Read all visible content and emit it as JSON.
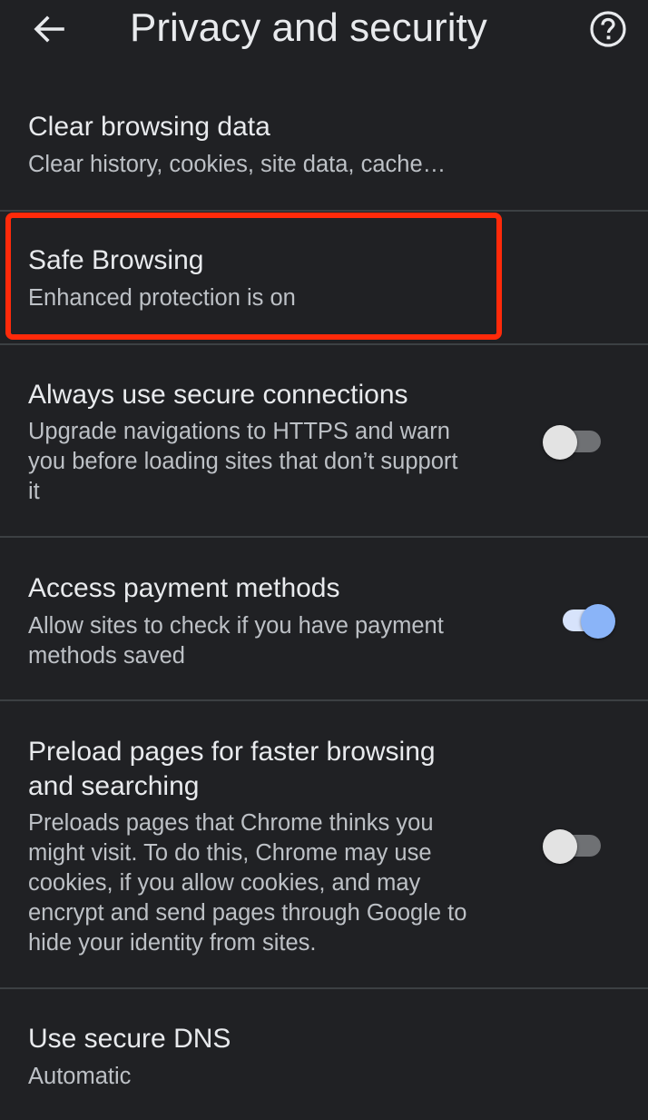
{
  "header": {
    "title": "Privacy and security",
    "back_icon": "arrow-left",
    "help_icon": "help-circle"
  },
  "rows": [
    {
      "title": "Clear browsing data",
      "subtitle": "Clear history, cookies, site data, cache…"
    },
    {
      "title": "Safe Browsing",
      "subtitle": "Enhanced protection is on"
    },
    {
      "title": "Always use secure connections",
      "subtitle": "Upgrade navigations to HTTPS and warn\nyou before loading sites that don’t support\nit",
      "toggle": "off"
    },
    {
      "title": "Access payment methods",
      "subtitle": "Allow sites to check if you have payment\nmethods saved",
      "toggle": "on"
    },
    {
      "title_line1": "Preload pages for faster browsing",
      "title_line2": "and searching",
      "subtitle": "Preloads pages that Chrome thinks you\nmight visit. To do this, Chrome may use\ncookies, if you allow cookies, and may\nencrypt and send pages through Google to\nhide your identity from sites.",
      "toggle": "off"
    },
    {
      "title": "Use secure DNS",
      "subtitle": "Automatic"
    }
  ],
  "colors": {
    "background": "#202124",
    "highlight": "#ff2a0a",
    "toggle_on": "#8ab4f8"
  }
}
